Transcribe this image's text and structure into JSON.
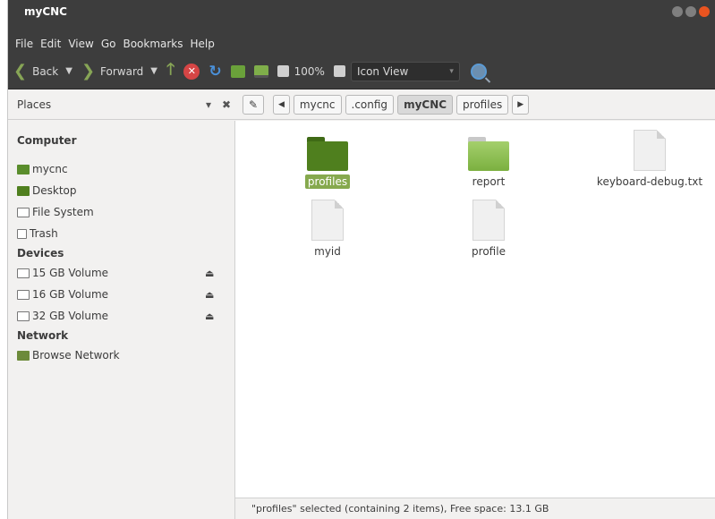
{
  "window": {
    "title": "myCNC",
    "colors": {
      "close": "#e95420",
      "min": "#7f7f7f",
      "max": "#7f7f7f"
    }
  },
  "menubar": [
    "File",
    "Edit",
    "View",
    "Go",
    "Bookmarks",
    "Help"
  ],
  "toolbar": {
    "back_label": "Back",
    "forward_label": "Forward",
    "zoom_label": "100%",
    "view_mode": "Icon View",
    "icons": [
      "back-chevron-icon",
      "forward-chevron-icon",
      "up-arrow-icon",
      "stop-icon",
      "reload-icon",
      "home-folder-icon",
      "computer-icon",
      "zoom-out-icon",
      "zoom-in-icon",
      "search-icon"
    ]
  },
  "places": {
    "header_label": "Places",
    "sections": [
      {
        "title": "Computer",
        "items": [
          {
            "label": "mycnc",
            "icon": "home-folder-icon"
          },
          {
            "label": "Desktop",
            "icon": "desktop-icon"
          },
          {
            "label": "File System",
            "icon": "drive-icon"
          },
          {
            "label": "Trash",
            "icon": "trash-icon"
          }
        ]
      },
      {
        "title": "Devices",
        "items": [
          {
            "label": "15 GB Volume",
            "icon": "drive-icon",
            "eject": true
          },
          {
            "label": "16 GB Volume",
            "icon": "drive-icon",
            "eject": true
          },
          {
            "label": "32 GB Volume",
            "icon": "usb-drive-icon",
            "eject": true
          }
        ]
      },
      {
        "title": "Network",
        "items": [
          {
            "label": "Browse Network",
            "icon": "network-icon"
          }
        ]
      }
    ]
  },
  "breadcrumb": [
    "mycnc",
    ".config",
    "myCNC",
    "profiles"
  ],
  "breadcrumb_active": "myCNC",
  "files": [
    {
      "name": "profiles",
      "type": "folder",
      "selected": true
    },
    {
      "name": "report",
      "type": "folder",
      "selected": false
    },
    {
      "name": "keyboard-debug.txt",
      "type": "file",
      "selected": false
    },
    {
      "name": "myid",
      "type": "file",
      "selected": false
    },
    {
      "name": "profile",
      "type": "file",
      "selected": false
    }
  ],
  "status_text": "\"profiles\" selected (containing 2 items), Free space: 13.1 GB",
  "colors": {
    "accent": "#87a556",
    "folder_dark": "#4f7f1e",
    "folder_light": "#8dbf52",
    "selection": "#86a94e"
  }
}
